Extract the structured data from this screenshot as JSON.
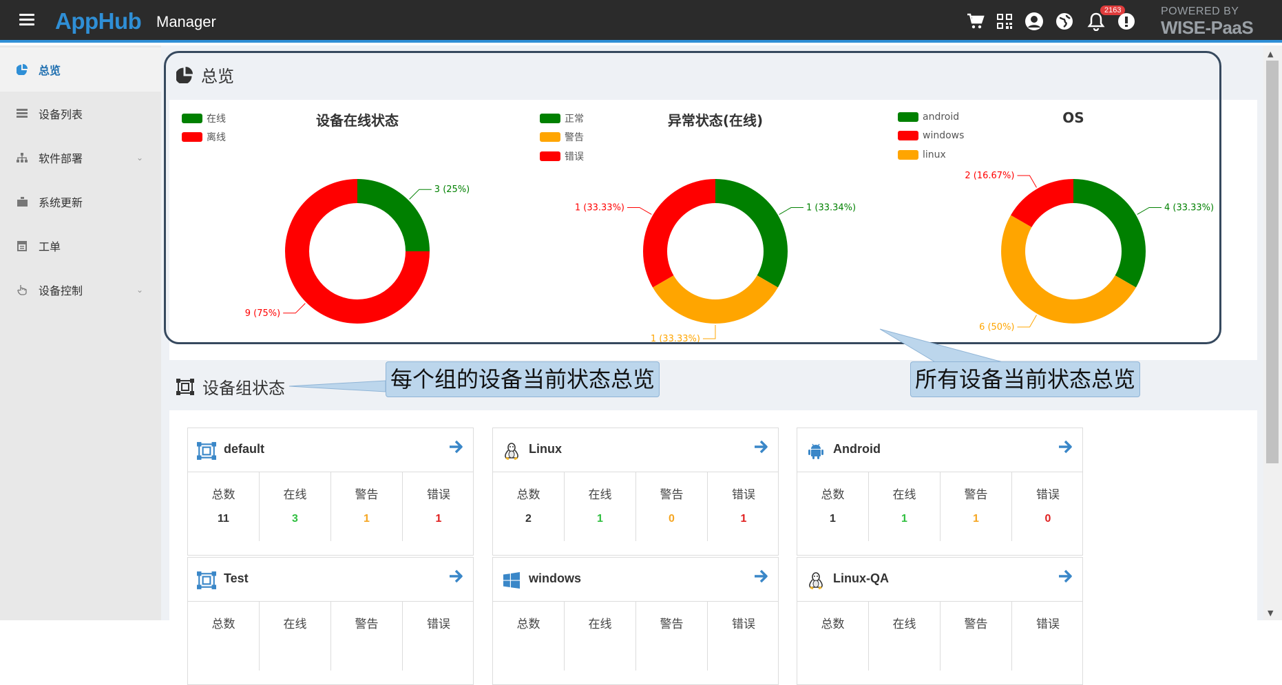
{
  "header": {
    "brand": "AppHub",
    "subtitle": "Manager",
    "notification_count": "2163",
    "powered_line1": "POWERED BY",
    "powered_line2": "WISE-PaaS"
  },
  "sidebar": {
    "items": [
      {
        "label": "总览",
        "icon": "pie-chart-icon",
        "active": true
      },
      {
        "label": "设备列表",
        "icon": "device-list-icon"
      },
      {
        "label": "软件部署",
        "icon": "sitemap-icon",
        "expandable": true
      },
      {
        "label": "系统更新",
        "icon": "briefcase-icon"
      },
      {
        "label": "工单",
        "icon": "calendar-icon"
      },
      {
        "label": "设备控制",
        "icon": "hand-pointer-icon",
        "expandable": true
      }
    ]
  },
  "overview": {
    "title": "总览",
    "charts": [
      {
        "title": "设备在线状态",
        "legend": [
          {
            "label": "在线",
            "color": "#008000"
          },
          {
            "label": "离线",
            "color": "#ff0000"
          }
        ],
        "labels": [
          "3 (25%)",
          "9 (75%)"
        ]
      },
      {
        "title": "异常状态(在线)",
        "legend": [
          {
            "label": "正常",
            "color": "#008000"
          },
          {
            "label": "警告",
            "color": "#ffa500"
          },
          {
            "label": "错误",
            "color": "#ff0000"
          }
        ],
        "labels": [
          "1 (33.34%)",
          "1 (33.33%)",
          "1 (33.33%)"
        ]
      },
      {
        "title": "OS",
        "legend": [
          {
            "label": "android",
            "color": "#008000"
          },
          {
            "label": "windows",
            "color": "#ff0000"
          },
          {
            "label": "linux",
            "color": "#ffa500"
          }
        ],
        "labels": [
          "4 (33.33%)",
          "6 (50%)",
          "2 (16.67%)"
        ]
      }
    ]
  },
  "chart_data": [
    {
      "type": "pie",
      "title": "设备在线状态",
      "categories": [
        "在线",
        "离线"
      ],
      "values": [
        3,
        9
      ],
      "colors": [
        "#008000",
        "#ff0000"
      ],
      "legend": "top-left"
    },
    {
      "type": "pie",
      "title": "异常状态(在线)",
      "categories": [
        "正常",
        "警告",
        "错误"
      ],
      "values": [
        1,
        1,
        1
      ],
      "percentages": [
        33.34,
        33.33,
        33.33
      ],
      "colors": [
        "#008000",
        "#ffa500",
        "#ff0000"
      ],
      "legend": "top-left"
    },
    {
      "type": "pie",
      "title": "OS",
      "categories": [
        "android",
        "linux",
        "windows"
      ],
      "values": [
        4,
        6,
        2
      ],
      "percentages": [
        33.33,
        50,
        16.67
      ],
      "colors": [
        "#008000",
        "#ffa500",
        "#ff0000"
      ],
      "legend": "top-left"
    }
  ],
  "callouts": {
    "group": "每个组的设备当前状态总览",
    "all": "所有设备当前状态总览"
  },
  "groups_section": {
    "title": "设备组状态",
    "stat_labels": [
      "总数",
      "在线",
      "警告",
      "错误"
    ],
    "stat_colors": [
      "#333333",
      "#2fbf3f",
      "#f5a623",
      "#e02020"
    ],
    "cards": [
      {
        "name": "default",
        "icon": "group-icon",
        "stats": [
          "11",
          "3",
          "1",
          "1"
        ]
      },
      {
        "name": "Linux",
        "icon": "linux-icon",
        "stats": [
          "2",
          "1",
          "0",
          "1"
        ]
      },
      {
        "name": "Android",
        "icon": "android-icon",
        "stats": [
          "1",
          "1",
          "1",
          "0"
        ]
      },
      {
        "name": "Test",
        "icon": "group-icon",
        "stats": [
          "",
          "",
          "",
          ""
        ]
      },
      {
        "name": "windows",
        "icon": "windows-icon",
        "stats": [
          "",
          "",
          "",
          ""
        ]
      },
      {
        "name": "Linux-QA",
        "icon": "linux-icon",
        "stats": [
          "",
          "",
          "",
          ""
        ]
      }
    ]
  }
}
